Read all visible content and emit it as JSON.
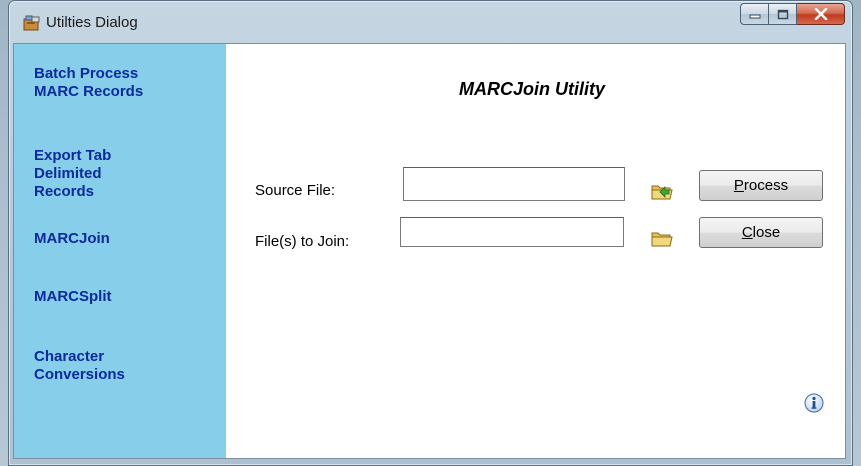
{
  "window": {
    "title": "Utilties Dialog"
  },
  "sidebar": {
    "items": [
      {
        "lines": [
          "Batch Process",
          "MARC Records"
        ]
      },
      {
        "lines": [
          "Export Tab",
          "Delimited",
          "Records"
        ]
      },
      {
        "lines": [
          "MARCJoin"
        ]
      },
      {
        "lines": [
          "MARCSplit"
        ]
      },
      {
        "lines": [
          "Character",
          "Conversions"
        ]
      }
    ]
  },
  "main": {
    "heading": "MARCJoin Utility",
    "source_file_label": "Source File:",
    "source_file_value": "",
    "join_files_label": "File(s) to Join:",
    "join_files_value": "",
    "process_button": {
      "mnemonic": "P",
      "rest": "rocess"
    },
    "close_button": {
      "mnemonic": "C",
      "rest": "lose"
    }
  },
  "icons": {
    "app": "utilities-app-icon",
    "source_browse": "folder-open-green-arrow-icon",
    "join_browse": "folder-icon",
    "info": "info-icon"
  },
  "colors": {
    "sidebar_bg": "#87ceeb",
    "nav_text": "#0c2a9c",
    "close_button_red": "#c13a1f"
  }
}
